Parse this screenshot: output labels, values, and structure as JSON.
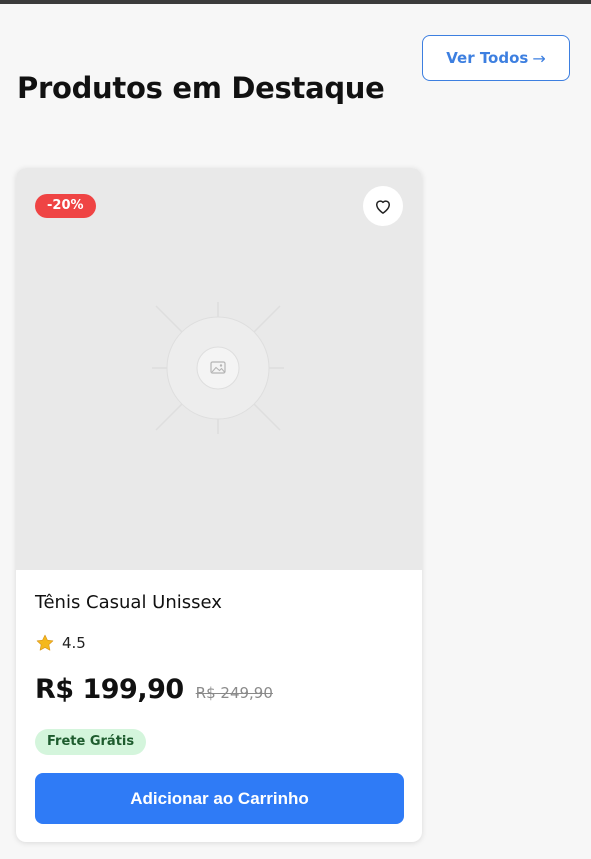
{
  "header": {
    "title": "Produtos em Destaque",
    "view_all_label": "Ver Todos",
    "view_all_arrow": "→"
  },
  "product": {
    "discount_badge": "-20%",
    "name": "Tênis Casual Unissex",
    "rating": "4.5",
    "price": "R$ 199,90",
    "old_price": "R$ 249,90",
    "shipping_badge": "Frete Grátis",
    "add_to_cart_label": "Adicionar ao Carrinho",
    "icons": {
      "favorite": "heart-icon",
      "rating": "star-icon",
      "image": "image-placeholder-icon"
    }
  },
  "colors": {
    "accent": "#2f7bf6",
    "discount": "#ef4444",
    "shipping_bg": "#d4f5dc",
    "shipping_text": "#1e5c2e",
    "star": "#f5b81c"
  }
}
